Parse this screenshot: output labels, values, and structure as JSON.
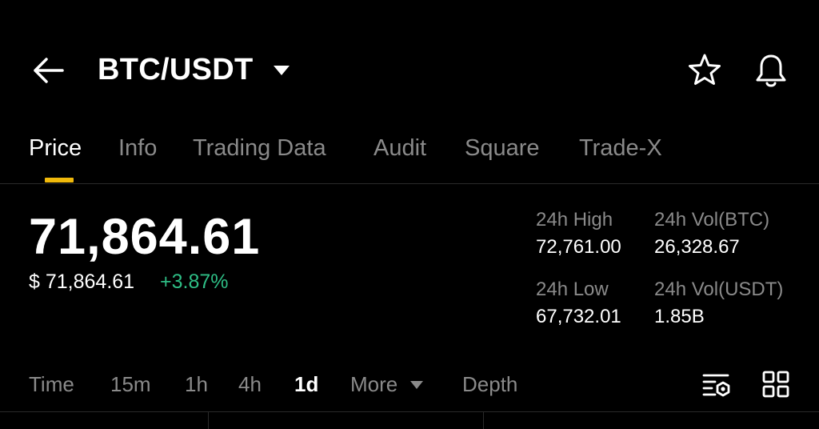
{
  "header": {
    "pair": "BTC/USDT"
  },
  "tabs": [
    {
      "label": "Price",
      "active": true
    },
    {
      "label": "Info"
    },
    {
      "label": "Trading Data"
    },
    {
      "label": "Audit"
    },
    {
      "label": "Square"
    },
    {
      "label": "Trade-X"
    }
  ],
  "price": {
    "last": "71,864.61",
    "usd": "$ 71,864.61",
    "change": "+3.87%"
  },
  "stats": {
    "high_label": "24h High",
    "high_value": "72,761.00",
    "vol_btc_label": "24h Vol(BTC)",
    "vol_btc_value": "26,328.67",
    "low_label": "24h Low",
    "low_value": "67,732.01",
    "vol_usdt_label": "24h Vol(USDT)",
    "vol_usdt_value": "1.85B"
  },
  "intervals": {
    "time": "Time",
    "m15": "15m",
    "h1": "1h",
    "h4": "4h",
    "d1": "1d",
    "more": "More",
    "depth": "Depth",
    "active": "1d"
  },
  "icons": {
    "back": "arrow-left-icon",
    "caret": "caret-down-icon",
    "star": "star-icon",
    "bell": "bell-icon",
    "settings": "chart-settings-icon",
    "grid": "grid-icon"
  },
  "colors": {
    "accent": "#f0b90b",
    "positive": "#2ebd85",
    "muted": "#8a8a8a",
    "background": "#000000"
  }
}
